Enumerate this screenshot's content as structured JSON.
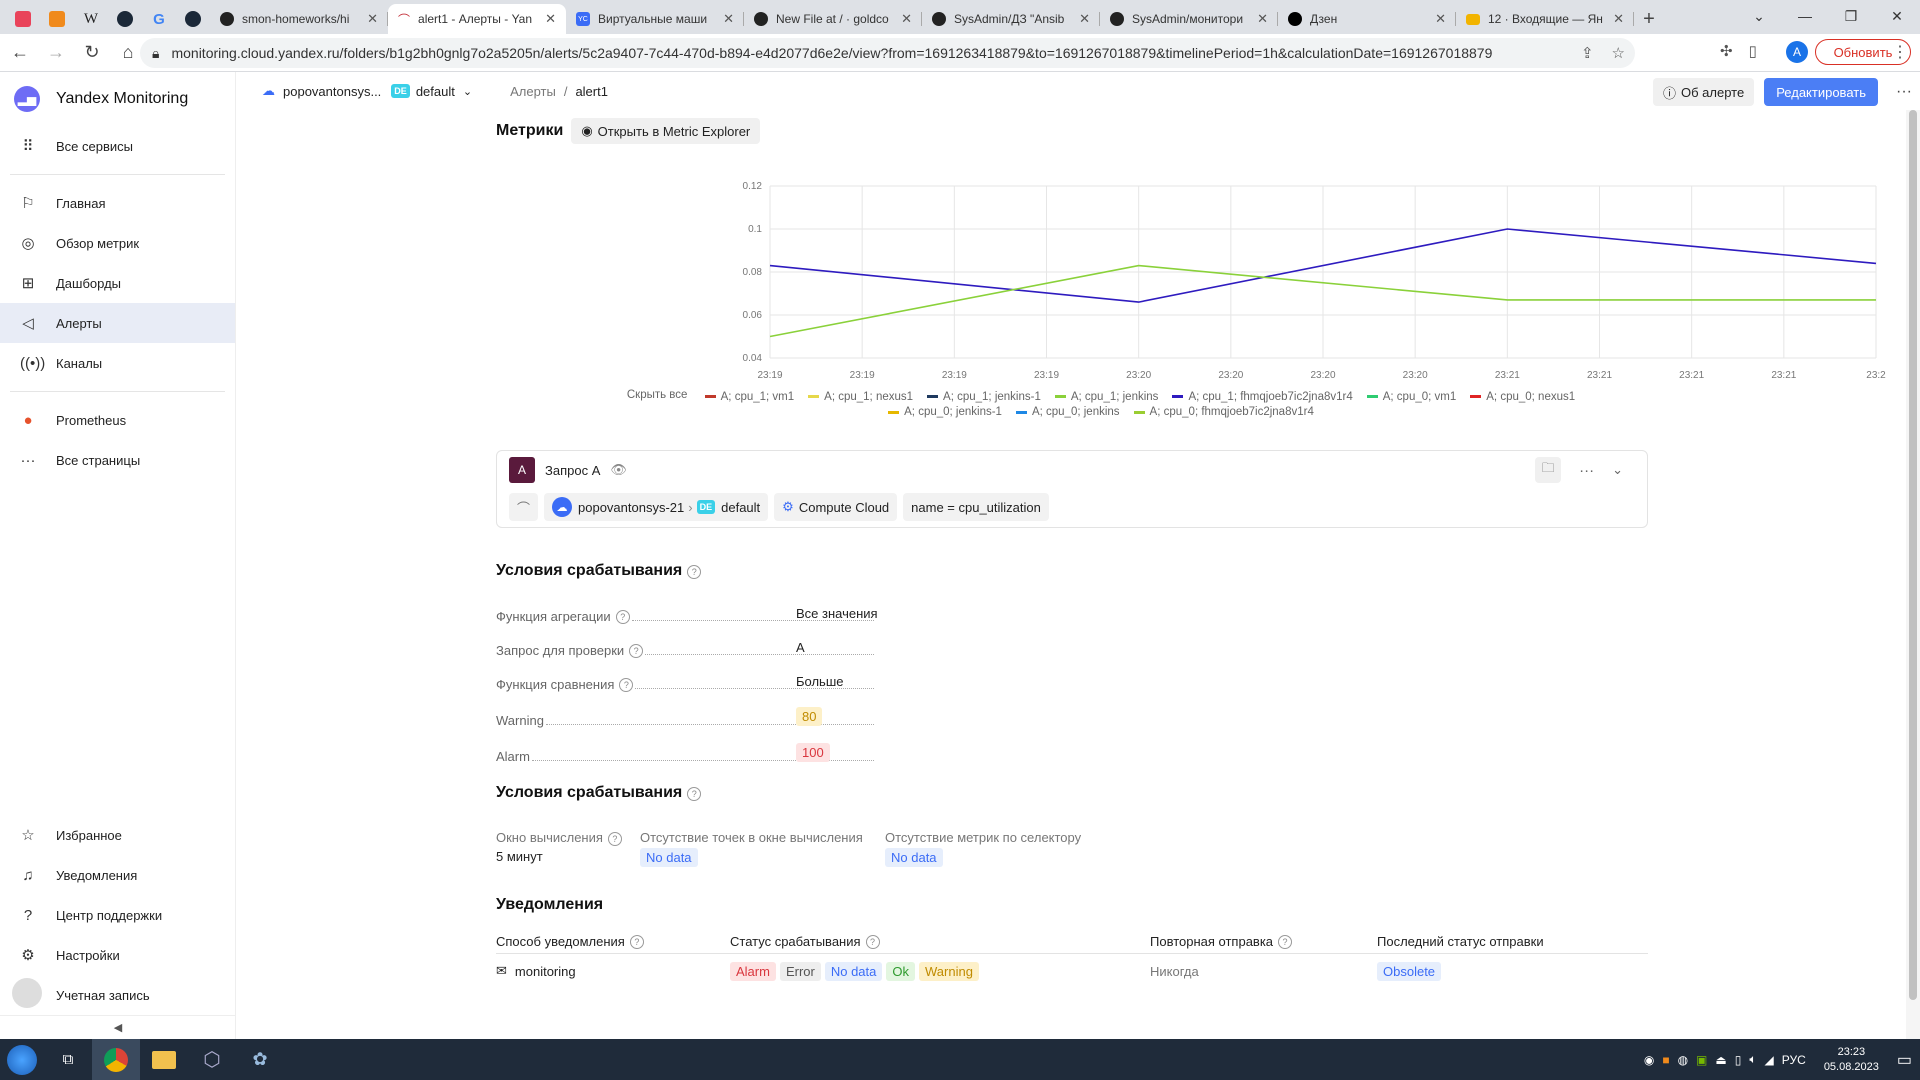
{
  "browser": {
    "tabs": [
      {
        "title": "smon-homeworks/hi",
        "icon": "github-icon"
      },
      {
        "title": "alert1 - Алерты - Yan",
        "icon": "monitoring-icon",
        "active": true
      },
      {
        "title": "Виртуальные маши",
        "icon": "yc-icon"
      },
      {
        "title": "New File at / · goldco",
        "icon": "github-icon"
      },
      {
        "title": "SysAdmin/ДЗ \"Ansib",
        "icon": "github-icon"
      },
      {
        "title": "SysAdmin/монитори",
        "icon": "github-icon"
      },
      {
        "title": "Дзен",
        "icon": "dzen-icon"
      },
      {
        "title": "12 · Входящие — Ян",
        "icon": "mail-icon"
      }
    ],
    "url": "monitoring.cloud.yandex.ru/folders/b1g2bh0gnlg7o2a5205n/alerts/5c2a9407-7c44-470d-b894-e4d2077d6e2e/view?from=1691263418879&to=1691267018879&timelinePeriod=1h&calculationDate=1691267018879",
    "profile_letter": "A",
    "update_label": "Обновить"
  },
  "sidebar": {
    "brand": "Yandex Monitoring",
    "all_services": "Все сервисы",
    "items": [
      {
        "label": "Главная",
        "icon": "flag-icon"
      },
      {
        "label": "Обзор метрик",
        "icon": "compass-icon"
      },
      {
        "label": "Дашборды",
        "icon": "grid-icon"
      },
      {
        "label": "Алерты",
        "icon": "megaphone-icon",
        "active": true
      },
      {
        "label": "Каналы",
        "icon": "broadcast-icon"
      }
    ],
    "prometheus": "Prometheus",
    "all_pages": "Все страницы",
    "bottom": [
      {
        "label": "Избранное",
        "icon": "star-icon"
      },
      {
        "label": "Уведомления",
        "icon": "bell-icon"
      },
      {
        "label": "Центр поддержки",
        "icon": "help-icon"
      },
      {
        "label": "Настройки",
        "icon": "gear-icon"
      },
      {
        "label": "Учетная запись",
        "icon": "user-icon"
      }
    ]
  },
  "header": {
    "cloud": "popovantonsys...",
    "folder_badge": "DE",
    "folder": "default",
    "breadcrumb_root": "Алерты",
    "breadcrumb_sep": "/",
    "breadcrumb_current": "alert1",
    "about_label": "Об алерте",
    "edit_label": "Редактировать"
  },
  "metrics": {
    "title": "Метрики",
    "explorer_label": "Открыть в Metric Explorer",
    "hide_all": "Скрыть все",
    "legend": [
      {
        "name": "A; cpu_1; vm1",
        "color": "#c0392b"
      },
      {
        "name": "A; cpu_1; nexus1",
        "color": "#e6d84a"
      },
      {
        "name": "A; cpu_1; jenkins-1",
        "color": "#1f3a5f"
      },
      {
        "name": "A; cpu_1; jenkins",
        "color": "#8ad13a"
      },
      {
        "name": "A; cpu_1; fhmqjoeb7ic2jna8v1r4",
        "color": "#2e1bbf"
      },
      {
        "name": "A; cpu_0; vm1",
        "color": "#2ecc71"
      },
      {
        "name": "A; cpu_0; nexus1",
        "color": "#e02424"
      },
      {
        "name": "A; cpu_0; jenkins-1",
        "color": "#e6b800"
      },
      {
        "name": "A; cpu_0; jenkins",
        "color": "#1e88e5"
      },
      {
        "name": "A; cpu_0; fhmqjoeb7ic2jna8v1r4",
        "color": "#9acd32"
      }
    ]
  },
  "chart_data": {
    "type": "line",
    "x": [
      "23:19",
      "23:19",
      "23:19",
      "23:19",
      "23:20",
      "23:20",
      "23:20",
      "23:20",
      "23:21",
      "23:21",
      "23:21",
      "23:21",
      "23:2"
    ],
    "ylim": [
      0.04,
      0.12
    ],
    "yticks": [
      "0.12",
      "0.1",
      "0.08",
      "0.06",
      "0.04"
    ],
    "grid": true,
    "series": [
      {
        "name": "A; cpu_1; fhmqjoeb7ic2jna8v1r4",
        "color": "#2e1bbf",
        "points": [
          [
            0,
            0.083
          ],
          [
            4,
            0.066
          ],
          [
            8,
            0.1
          ],
          [
            12,
            0.084
          ]
        ]
      },
      {
        "name": "A; cpu_0; fhmqjoeb7ic2jna8v1r4",
        "color": "#8ad13a",
        "points": [
          [
            0,
            0.05
          ],
          [
            4,
            0.083
          ],
          [
            8,
            0.067
          ],
          [
            12,
            0.067
          ]
        ]
      }
    ]
  },
  "query": {
    "badge": "A",
    "title": "Запрос A",
    "cloud": "popovantonsys-21",
    "folder_badge": "DE",
    "folder": "default",
    "service": "Compute Cloud",
    "selector": "name = cpu_utilization"
  },
  "conditions": {
    "title": "Условия срабатывания",
    "rows": [
      {
        "label": "Функция агрегации",
        "value": "Все значения"
      },
      {
        "label": "Запрос для проверки",
        "value": "A"
      },
      {
        "label": "Функция сравнения",
        "value": "Больше"
      },
      {
        "label": "Warning",
        "value": "80"
      },
      {
        "label": "Alarm",
        "value": "100"
      }
    ]
  },
  "conditions2": {
    "title": "Условия срабатывания",
    "window_label": "Окно вычисления",
    "window_value": "5 минут",
    "no_points_label": "Отсутствие точек в окне вычисления",
    "no_points_value": "No data",
    "no_metrics_label": "Отсутствие метрик по селектору",
    "no_metrics_value": "No data"
  },
  "notifications": {
    "title": "Уведомления",
    "headers": [
      "Способ уведомления",
      "Статус срабатывания",
      "Повторная отправка",
      "Последний статус отправки"
    ],
    "row": {
      "method": "monitoring",
      "statuses": [
        "Alarm",
        "Error",
        "No data",
        "Ok",
        "Warning"
      ],
      "repeat": "Никогда",
      "last_status": "Obsolete"
    }
  },
  "taskbar": {
    "lang": "РУС",
    "time": "23:23",
    "date": "05.08.2023"
  }
}
